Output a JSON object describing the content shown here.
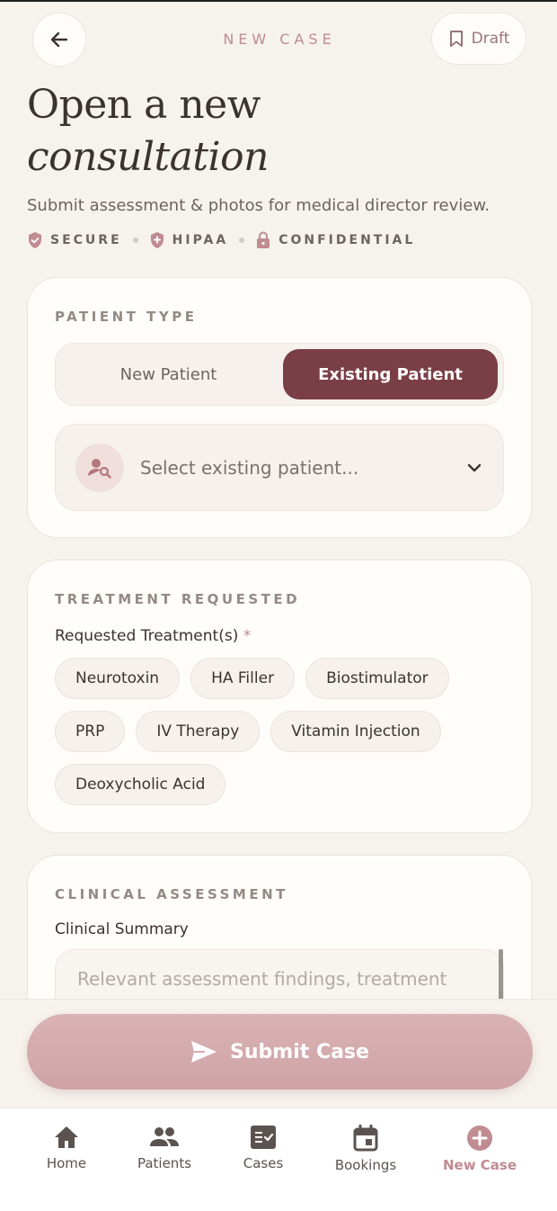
{
  "header": {
    "title": "NEW CASE",
    "draft_label": "Draft"
  },
  "hero": {
    "title_line1": "Open a new",
    "title_line2": "consultation",
    "subtitle": "Submit assessment & photos for medical director review.",
    "badges": [
      "SECURE",
      "HIPAA",
      "CONFIDENTIAL"
    ]
  },
  "patient_type": {
    "label": "PATIENT TYPE",
    "options": [
      "New Patient",
      "Existing Patient"
    ],
    "selected": "Existing Patient",
    "select_placeholder": "Select existing patient..."
  },
  "treatment": {
    "label": "TREATMENT REQUESTED",
    "field_label": "Requested Treatment(s)",
    "required_mark": "*",
    "chips": [
      "Neurotoxin",
      "HA Filler",
      "Biostimulator",
      "PRP",
      "IV Therapy",
      "Vitamin Injection",
      "Deoxycholic Acid"
    ]
  },
  "clinical": {
    "label": "CLINICAL ASSESSMENT",
    "field_label": "Clinical Summary",
    "placeholder": "Relevant assessment findings, treatment"
  },
  "submit": {
    "label": "Submit Case"
  },
  "nav": {
    "items": [
      {
        "label": "Home",
        "icon": "home-icon"
      },
      {
        "label": "Patients",
        "icon": "people-icon"
      },
      {
        "label": "Cases",
        "icon": "cases-icon"
      },
      {
        "label": "Bookings",
        "icon": "calendar-icon"
      },
      {
        "label": "New Case",
        "icon": "plus-circle-icon"
      }
    ],
    "active": "New Case"
  },
  "colors": {
    "accent": "#7a3f46",
    "accent_soft": "#c08b91",
    "background": "#f6f2ec",
    "card": "#fffdfa",
    "submit": "#d4a9ac"
  }
}
